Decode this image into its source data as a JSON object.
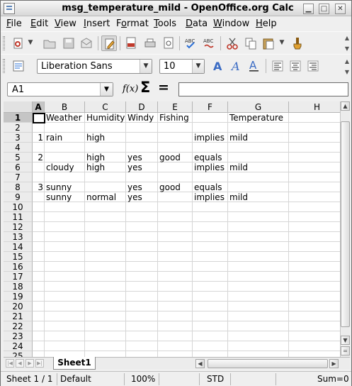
{
  "window": {
    "title": "msg_temperature_mild - OpenOffice.org Calc"
  },
  "menu": [
    "File",
    "Edit",
    "View",
    "Insert",
    "Format",
    "Tools",
    "Data",
    "Window",
    "Help"
  ],
  "menu_mnemonic": [
    "F",
    "E",
    "V",
    "I",
    "o",
    "T",
    "D",
    "W",
    "H"
  ],
  "format": {
    "font_name": "Liberation Sans",
    "font_size": "10"
  },
  "formula_bar": {
    "name_box": "A1",
    "fx_symbol": "f(x)",
    "sum_symbol": "Σ",
    "equals_symbol": "=",
    "content": ""
  },
  "columns": [
    "A",
    "B",
    "C",
    "D",
    "E",
    "F",
    "G",
    "H"
  ],
  "rows": [
    "1",
    "2",
    "3",
    "4",
    "5",
    "6",
    "7",
    "8",
    "9",
    "10",
    "11",
    "12",
    "13",
    "14",
    "15",
    "16",
    "17",
    "18",
    "19",
    "20",
    "21",
    "22",
    "23",
    "24",
    "25"
  ],
  "cells": {
    "B1": "Weather",
    "C1": "Humidity",
    "D1": "Windy",
    "E1": "Fishing",
    "G1": "Temperature",
    "A3": "1",
    "B3": "rain",
    "C3": "high",
    "F3": "implies",
    "G3": "mild",
    "A5": "2",
    "C5": "high",
    "D5": "yes",
    "E5": "good",
    "F5": "equals",
    "B6": "cloudy",
    "C6": "high",
    "D6": "yes",
    "F6": "implies",
    "G6": "mild",
    "A8": "3",
    "B8": "sunny",
    "D8": "yes",
    "E8": "good",
    "F8": "equals",
    "B9": "sunny",
    "C9": "normal",
    "D9": "yes",
    "F9": "implies",
    "G9": "mild"
  },
  "sheet_tabs": [
    "Sheet1"
  ],
  "statusbar": {
    "sheet": "Sheet 1 / 1",
    "style": "Default",
    "zoom": "100%",
    "mode": "STD",
    "sum": "Sum=0"
  }
}
